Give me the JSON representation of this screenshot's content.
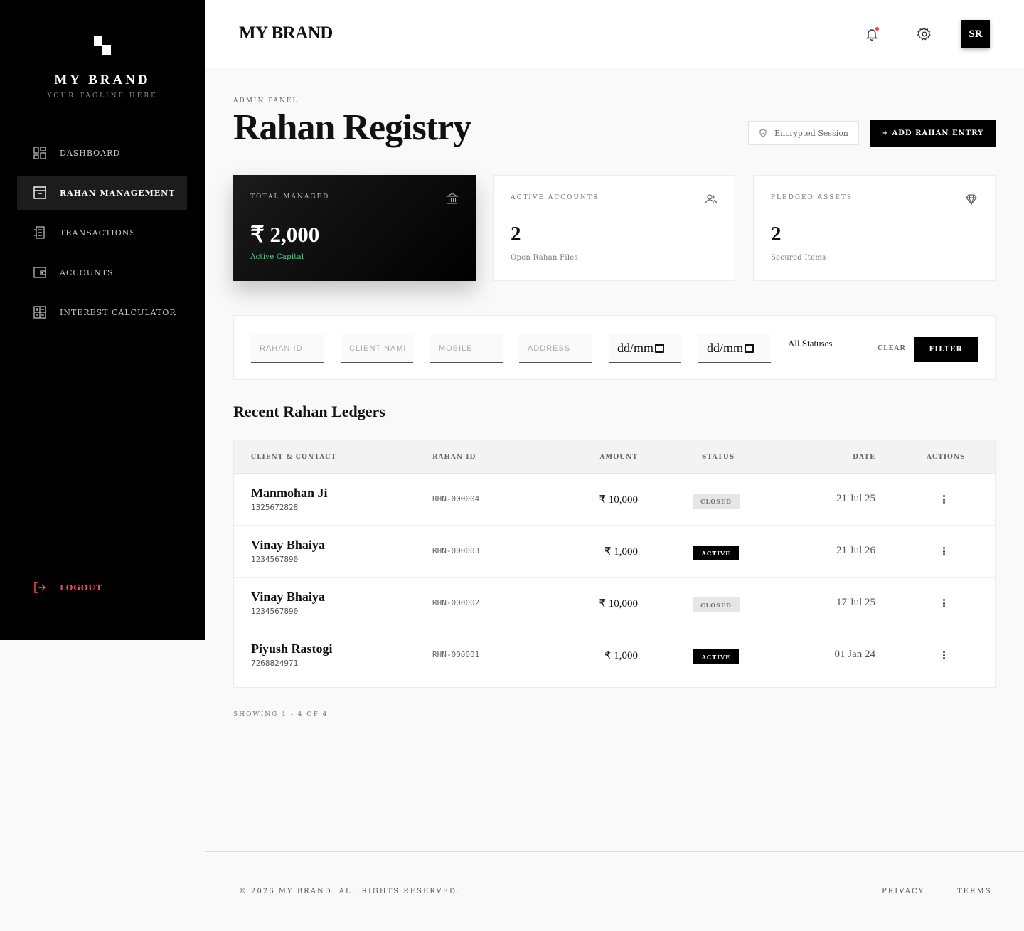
{
  "sidebar": {
    "brand": "MY BRAND",
    "tagline": "YOUR TAGLINE HERE",
    "items": [
      {
        "label": "DASHBOARD",
        "icon": "grid-icon"
      },
      {
        "label": "RAHAN MANAGEMENT",
        "icon": "archive-icon",
        "active": true
      },
      {
        "label": "TRANSACTIONS",
        "icon": "receipt-icon"
      },
      {
        "label": "ACCOUNTS",
        "icon": "wallet-icon"
      },
      {
        "label": "INTEREST CALCULATOR",
        "icon": "calculator-icon"
      }
    ],
    "logout": "LOGOUT"
  },
  "topbar": {
    "brand": "MY BRAND",
    "avatar": "SR"
  },
  "header": {
    "eyebrow": "ADMIN PANEL",
    "title": "Rahan Registry",
    "encrypted": "Encrypted Session",
    "add_button": "+ ADD RAHAN ENTRY"
  },
  "stats": [
    {
      "label": "TOTAL MANAGED",
      "value": "₹ 2,000",
      "sub": "Active Capital",
      "icon": "bank-icon"
    },
    {
      "label": "ACTIVE ACCOUNTS",
      "value": "2",
      "sub": "Open Rahan Files",
      "icon": "users-icon"
    },
    {
      "label": "PLEDGED ASSETS",
      "value": "2",
      "sub": "Secured Items",
      "icon": "diamond-icon"
    }
  ],
  "filters": {
    "rahan_id": "RAHAN ID",
    "client_name": "CLIENT NAME",
    "mobile": "MOBILE",
    "address": "ADDRESS",
    "date_from": "dd/mm",
    "date_to": "dd/mm",
    "status": "All Statuses",
    "clear": "CLEAR",
    "filter": "FILTER"
  },
  "ledger": {
    "title": "Recent Rahan Ledgers",
    "columns": [
      "CLIENT & CONTACT",
      "RAHAN ID",
      "AMOUNT",
      "STATUS",
      "DATE",
      "ACTIONS"
    ],
    "rows": [
      {
        "name": "Manmohan Ji",
        "phone": "1325672828",
        "id": "RHN-000004",
        "amount": "₹ 10,000",
        "status": "CLOSED",
        "date": "21 Jul 25"
      },
      {
        "name": "Vinay Bhaiya",
        "phone": "1234567890",
        "id": "RHN-000003",
        "amount": "₹ 1,000",
        "status": "ACTIVE",
        "date": "21 Jul 26"
      },
      {
        "name": "Vinay Bhaiya",
        "phone": "1234567890",
        "id": "RHN-000002",
        "amount": "₹ 10,000",
        "status": "CLOSED",
        "date": "17 Jul 25"
      },
      {
        "name": "Piyush Rastogi",
        "phone": "7268824971",
        "id": "RHN-000001",
        "amount": "₹ 1,000",
        "status": "ACTIVE",
        "date": "01 Jan 24"
      }
    ],
    "showing": "SHOWING 1 - 4 OF 4"
  },
  "footer": {
    "copyright": "© 2026 MY BRAND. ALL RIGHTS RESERVED.",
    "privacy": "PRIVACY",
    "terms": "TERMS"
  },
  "colors": {
    "accent": "#000000",
    "logout": "#ff4a4a",
    "positive": "#4fd18b",
    "notification": "#ff3b3b"
  }
}
